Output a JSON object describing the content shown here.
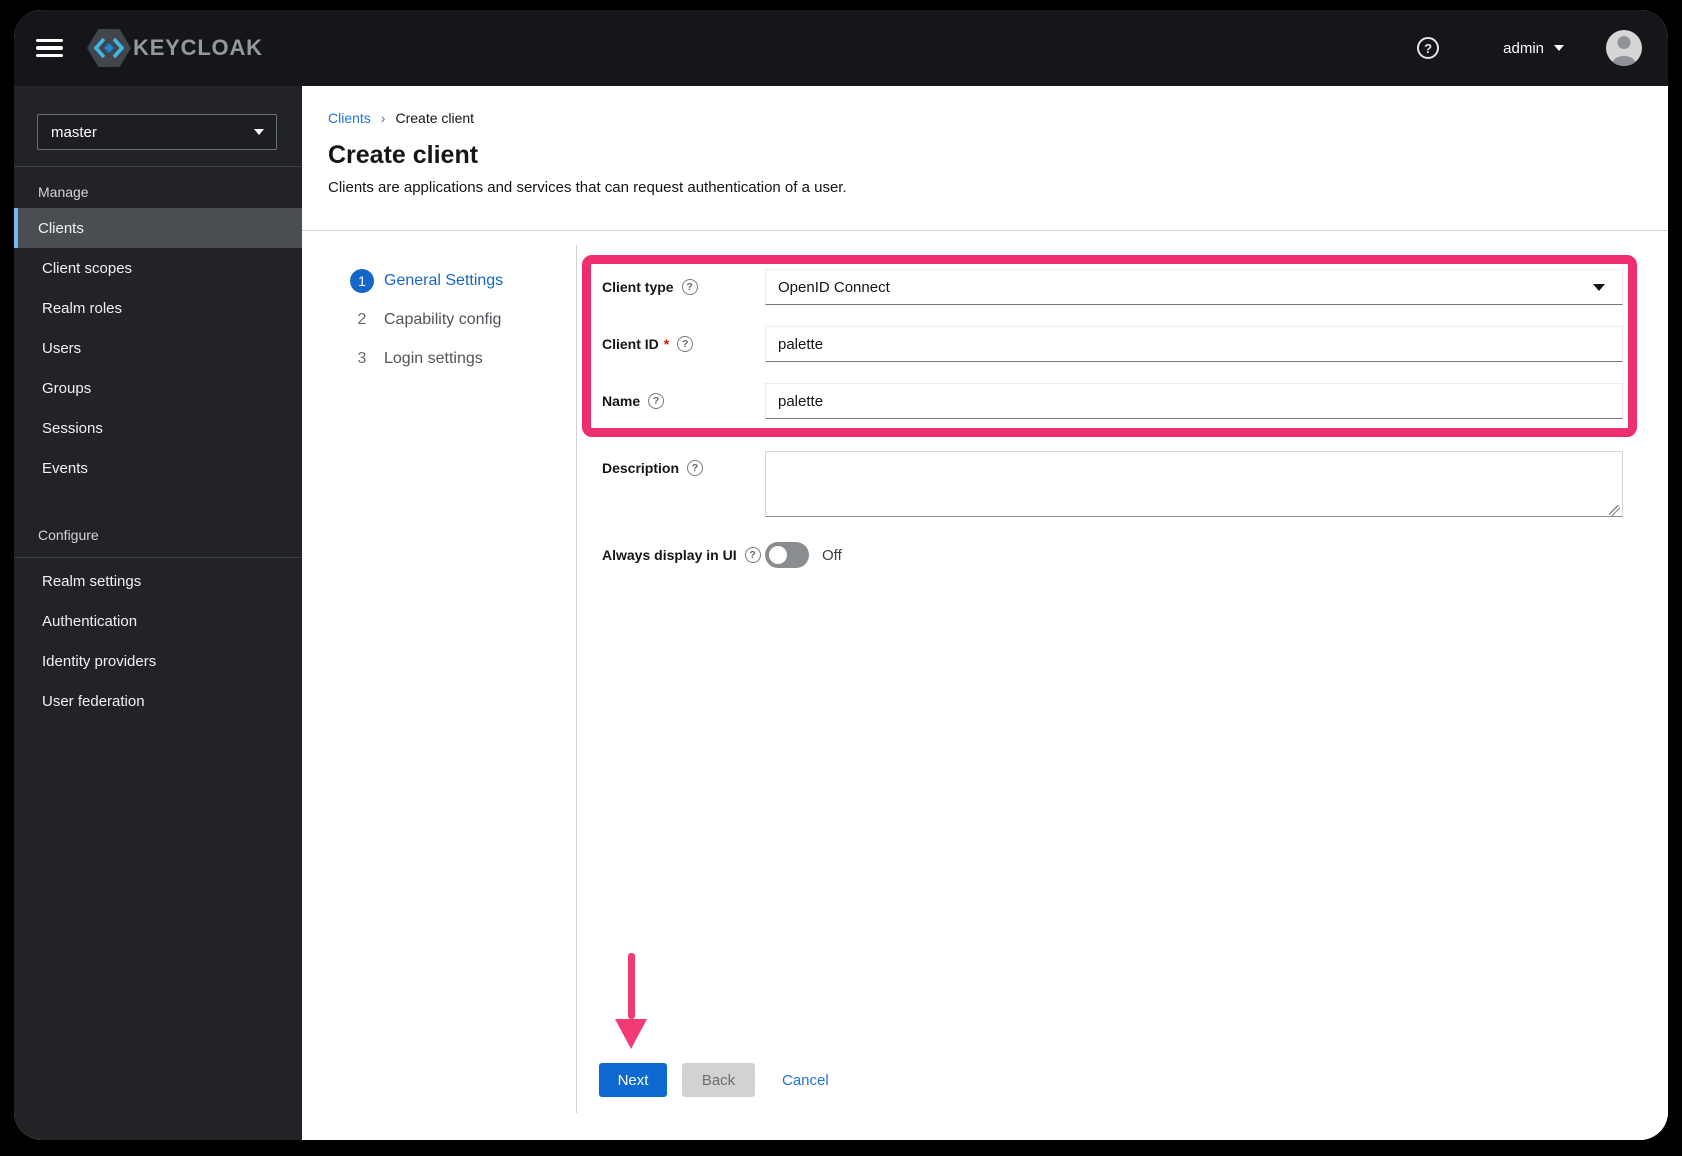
{
  "header": {
    "logo_text": "KEYCLOAK",
    "user_name": "admin"
  },
  "icons": {
    "help": "?"
  },
  "sidebar": {
    "realm": "master",
    "sections": [
      {
        "title": "Manage",
        "items": [
          {
            "label": "Clients",
            "selected": true
          },
          {
            "label": "Client scopes"
          },
          {
            "label": "Realm roles"
          },
          {
            "label": "Users"
          },
          {
            "label": "Groups"
          },
          {
            "label": "Sessions"
          },
          {
            "label": "Events"
          }
        ]
      },
      {
        "title": "Configure",
        "items": [
          {
            "label": "Realm settings"
          },
          {
            "label": "Authentication"
          },
          {
            "label": "Identity providers"
          },
          {
            "label": "User federation"
          }
        ]
      }
    ]
  },
  "breadcrumb": {
    "parent": "Clients",
    "separator": "›",
    "current": "Create client"
  },
  "page": {
    "title": "Create client",
    "subtitle": "Clients are applications and services that can request authentication of a user."
  },
  "wizard": {
    "steps": [
      {
        "number": "1",
        "label": "General Settings",
        "active": true
      },
      {
        "number": "2",
        "label": "Capability config",
        "active": false
      },
      {
        "number": "3",
        "label": "Login settings",
        "active": false
      }
    ]
  },
  "form": {
    "client_type": {
      "label": "Client type",
      "value": "OpenID Connect"
    },
    "client_id": {
      "label": "Client ID",
      "required": "*",
      "value": "palette"
    },
    "name": {
      "label": "Name",
      "value": "palette"
    },
    "description": {
      "label": "Description",
      "value": ""
    },
    "always_display": {
      "label": "Always display in UI",
      "state": "Off"
    }
  },
  "actions": {
    "next": "Next",
    "back": "Back",
    "cancel": "Cancel"
  },
  "colors": {
    "annotation_pink": "#ee2e6e",
    "primary_blue": "#0d69cf",
    "link_blue": "#2174d8",
    "nav_accent": "#73bcf7"
  }
}
